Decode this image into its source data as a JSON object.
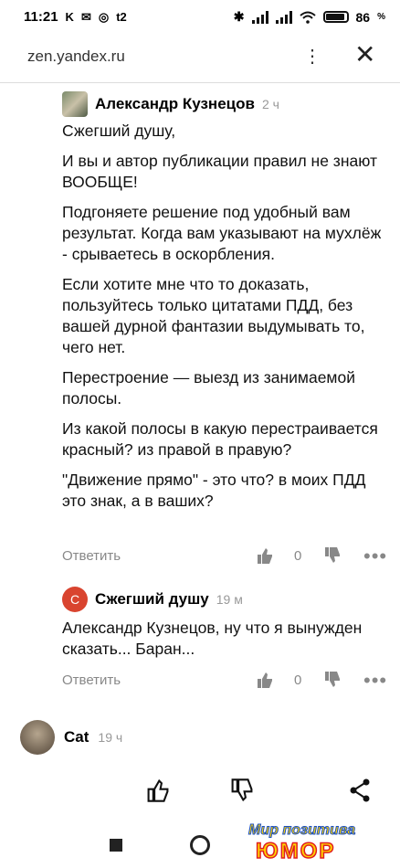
{
  "status": {
    "time": "11:21",
    "battery": "86"
  },
  "browser": {
    "url": "zen.yandex.ru"
  },
  "comments": [
    {
      "author": "Александр Кузнецов",
      "time": "2 ч",
      "paragraphs": [
        "Сжегший душу,",
        "И вы и автор публикации правил не знают ВООБЩЕ!",
        "Подгоняете решение под удобный вам результат. Когда вам указывают на мухлёж - срываетесь в оскорбления.",
        "Если хотите мне что то доказать, пользуйтесь только цитатами ПДД, без вашей дурной фантазии выдумывать то, чего нет.",
        "Перестроение — выезд из занимаемой полосы.",
        "Из какой полосы в какую перестраивается красный? из правой в правую?",
        "\"Движение прямо\" - это что? в моих ПДД это знак, а в ваших?"
      ],
      "reply_label": "Ответить",
      "likes": "0"
    },
    {
      "author": "Сжегший душу",
      "avatar_letter": "С",
      "time": "19 м",
      "paragraphs": [
        "Александр Кузнецов, ну что я вынужден сказать... Баран..."
      ],
      "reply_label": "Ответить",
      "likes": "0"
    },
    {
      "author": "Cat",
      "time": "19 ч"
    }
  ],
  "watermark": {
    "line1": "Мир позитива",
    "line2": "ЮМОР"
  },
  "colors": {
    "avatar_red": "#d9442f",
    "muted": "#888888"
  }
}
